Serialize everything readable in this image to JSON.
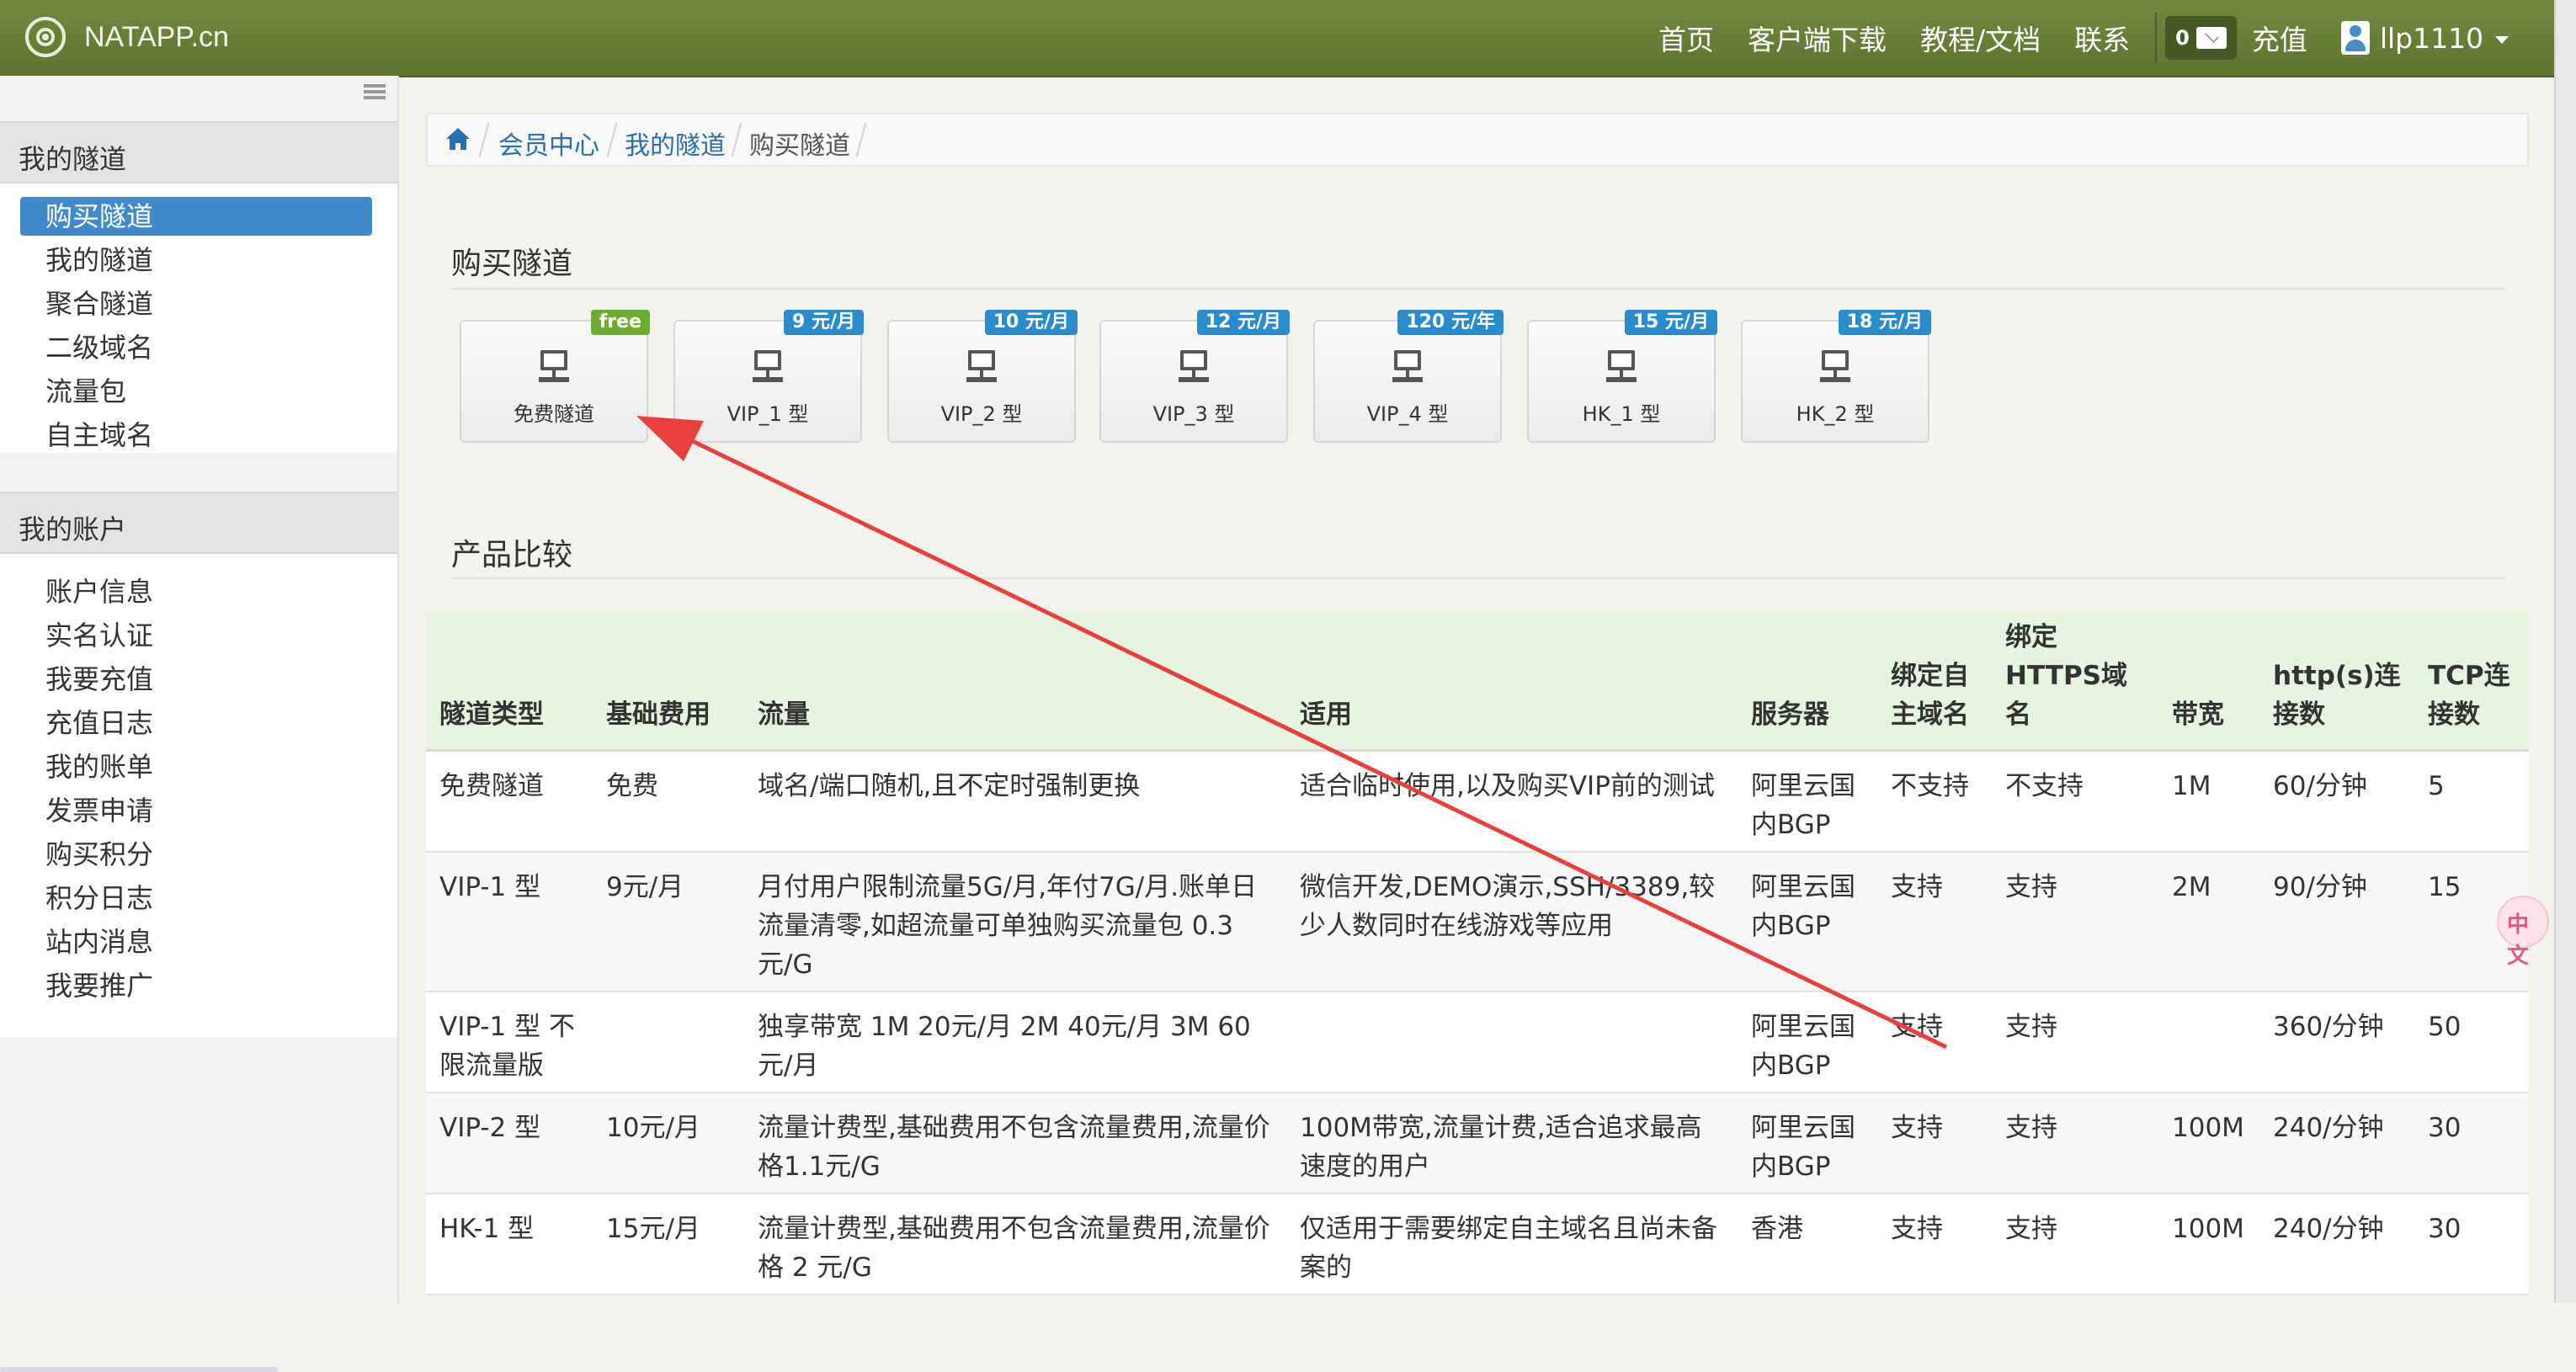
{
  "navbar": {
    "brand": "NATAPP.cn",
    "links": [
      "首页",
      "客户端下载",
      "教程/文档",
      "联系"
    ],
    "mail_count": "0",
    "recharge": "充值",
    "username": "llp1110"
  },
  "sidebar": {
    "section1_title": "我的隧道",
    "section1_items": [
      "购买隧道",
      "我的隧道",
      "聚合隧道",
      "二级域名",
      "流量包",
      "自主域名"
    ],
    "section2_title": "我的账户",
    "section2_items": [
      "账户信息",
      "实名认证",
      "我要充值",
      "充值日志",
      "我的账单",
      "发票申请",
      "购买积分",
      "积分日志",
      "站内消息",
      "我要推广"
    ]
  },
  "breadcrumb": [
    "会员中心",
    "我的隧道",
    "购买隧道"
  ],
  "buy_title": "购买隧道",
  "tunnels": [
    {
      "label": "免费隧道",
      "badge": "free"
    },
    {
      "label": "VIP_1 型",
      "badge": "9 元/月"
    },
    {
      "label": "VIP_2 型",
      "badge": "10 元/月"
    },
    {
      "label": "VIP_3 型",
      "badge": "12 元/月"
    },
    {
      "label": "VIP_4 型",
      "badge": "120 元/年"
    },
    {
      "label": "HK_1 型",
      "badge": "15 元/月"
    },
    {
      "label": "HK_2 型",
      "badge": "18 元/月"
    }
  ],
  "compare_title": "产品比较",
  "table": {
    "headers": [
      "隧道类型",
      "基础费用",
      "流量",
      "适用",
      "服务器",
      "绑定自主域名",
      "绑定HTTPS域名",
      "带宽",
      "http(s)连接数",
      "TCP连接数"
    ],
    "rows": [
      [
        "免费隧道",
        "免费",
        "域名/端口随机,且不定时强制更换",
        "适合临时使用,以及购买VIP前的测试",
        "阿里云国内BGP",
        "不支持",
        "不支持",
        "1M",
        "60/分钟",
        "5"
      ],
      [
        "VIP-1 型",
        "9元/月",
        "月付用户限制流量5G/月,年付7G/月.账单日流量清零,如超流量可单独购买流量包 0.3元/G",
        "微信开发,DEMO演示,SSH/3389,较少人数同时在线游戏等应用",
        "阿里云国内BGP",
        "支持",
        "支持",
        "2M",
        "90/分钟",
        "15"
      ],
      [
        "VIP-1 型 不限流量版",
        "",
        "独享带宽 1M 20元/月 2M 40元/月 3M 60元/月",
        "",
        "阿里云国内BGP",
        "支持",
        "支持",
        "",
        "360/分钟",
        "50"
      ],
      [
        "VIP-2 型",
        "10元/月",
        "流量计费型,基础费用不包含流量费用,流量价格1.1元/G",
        "100M带宽,流量计费,适合追求最高速度的用户",
        "阿里云国内BGP",
        "支持",
        "支持",
        "100M",
        "240/分钟",
        "30"
      ],
      [
        "HK-1 型",
        "15元/月",
        "流量计费型,基础费用不包含流量费用,流量价格 2 元/G",
        "仅适用于需要绑定自主域名且尚未备案的",
        "香港",
        "支持",
        "支持",
        "100M",
        "240/分钟",
        "30"
      ]
    ]
  },
  "float_button": "中文",
  "colors": {
    "navbar": "#68803a",
    "active_item": "#428bca",
    "badge_blue": "#2b8ccc",
    "badge_green": "#6eab34",
    "table_header": "#e8f4e2",
    "arrow": "#e8413d"
  }
}
